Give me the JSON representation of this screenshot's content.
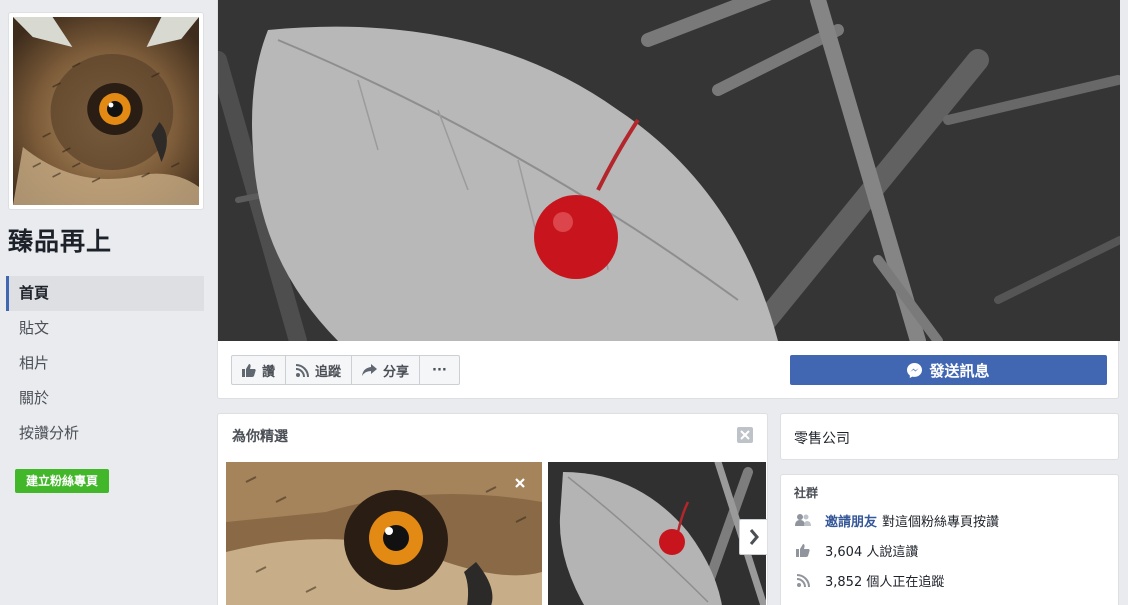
{
  "page": {
    "name": "臻品再上"
  },
  "nav": {
    "items": [
      "首頁",
      "貼文",
      "相片",
      "關於",
      "按讚分析"
    ],
    "create_page": "建立粉絲專頁"
  },
  "actions": {
    "like": "讚",
    "follow": "追蹤",
    "share": "分享",
    "more": "···",
    "send_message": "發送訊息"
  },
  "picked": {
    "title": "為你精選"
  },
  "category": "零售公司",
  "community": {
    "title": "社群",
    "invite_link": "邀請朋友",
    "invite_text": "對這個粉絲專頁按讚",
    "likes_text": "3,604 人說這讚",
    "follows_text": "3,852 個人正在追蹤"
  },
  "colors": {
    "brand_blue": "#4267b2",
    "green": "#42b72a",
    "link": "#365899"
  },
  "icons": [
    "thumbs-up-icon",
    "rss-icon",
    "share-arrow-icon",
    "messenger-icon",
    "close-icon",
    "chevron-right-icon",
    "friends-icon"
  ]
}
